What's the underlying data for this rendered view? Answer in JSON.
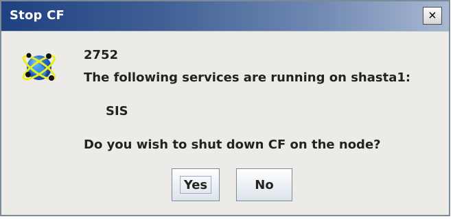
{
  "window": {
    "title": "Stop CF",
    "close_label": "×"
  },
  "message": {
    "code": "2752",
    "line": "The following services are running on shasta1:",
    "service": "SIS",
    "question": "Do you wish to shut down CF on the node?"
  },
  "buttons": {
    "yes": "Yes",
    "no": "No"
  },
  "icons": {
    "app": "globe-atom-icon",
    "close": "close-icon"
  },
  "colors": {
    "title_bar_start": "#1f4180",
    "title_bar_end": "#a8b8d1",
    "dialog_background": "#ecebe8",
    "button_border": "#7a8a99"
  }
}
